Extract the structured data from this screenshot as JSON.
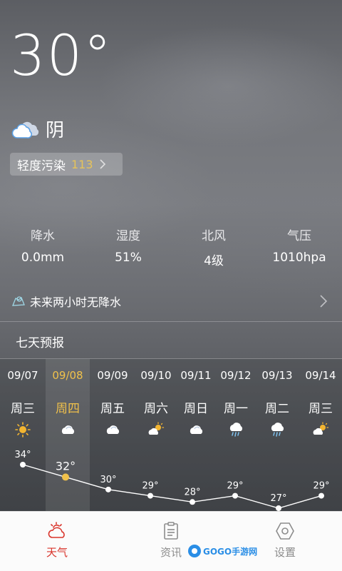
{
  "current": {
    "temperature": "30°",
    "condition": "阴",
    "condition_icon": "cloudy-icon",
    "aqi_label": "轻度污染",
    "aqi_value": "113",
    "aqi_color": "#e6c35a"
  },
  "stats": [
    {
      "label": "降水",
      "value": "0.0mm"
    },
    {
      "label": "湿度",
      "value": "51%"
    },
    {
      "label": "北风",
      "value": "4级"
    },
    {
      "label": "气压",
      "value": "1010hpa"
    }
  ],
  "rain_notice": "未来两小时无降水",
  "forecast_title": "七天预报",
  "forecast": [
    {
      "date": "09/07",
      "weekday": "周三",
      "icon": "sunny-icon",
      "temp": "34°"
    },
    {
      "date": "09/08",
      "weekday": "周四",
      "icon": "cloudy-icon",
      "temp": "32°"
    },
    {
      "date": "09/09",
      "weekday": "周五",
      "icon": "cloudy-icon",
      "temp": "30°"
    },
    {
      "date": "09/10",
      "weekday": "周六",
      "icon": "partly-cloudy-icon",
      "temp": "29°"
    },
    {
      "date": "09/11",
      "weekday": "周日",
      "icon": "cloudy-icon",
      "temp": "28°"
    },
    {
      "date": "09/12",
      "weekday": "周一",
      "icon": "rain-icon",
      "temp": "29°"
    },
    {
      "date": "09/13",
      "weekday": "周二",
      "icon": "rain-icon",
      "temp": "27°"
    },
    {
      "date": "09/14",
      "weekday": "周三",
      "icon": "partly-cloudy-icon",
      "temp": "29°"
    }
  ],
  "forecast_temps": [
    34,
    32,
    30,
    29,
    28,
    29,
    27,
    29
  ],
  "today_index": 1,
  "tabs": [
    {
      "label": "天气",
      "icon": "weather-icon"
    },
    {
      "label": "资讯",
      "icon": "news-icon"
    },
    {
      "label": "设置",
      "icon": "settings-icon"
    }
  ],
  "watermark": "GOGO手游网",
  "colors": {
    "accent_today": "#f0c14b",
    "tab_active": "#d9342b"
  }
}
